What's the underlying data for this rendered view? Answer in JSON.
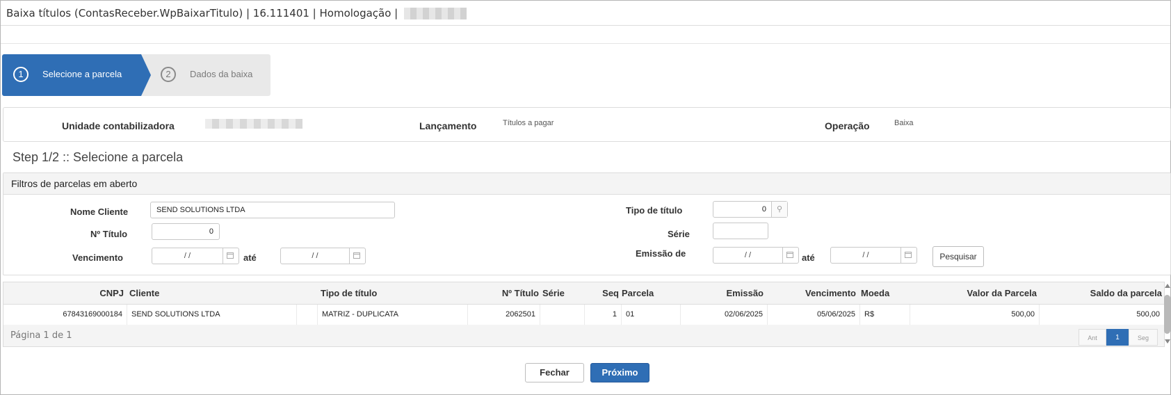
{
  "window": {
    "title": "Baixa títulos (ContasReceber.WpBaixarTitulo) | 16.111401 | Homologação |"
  },
  "wizard": {
    "steps": [
      {
        "number": "1",
        "label": "Selecione a parcela",
        "active": true
      },
      {
        "number": "2",
        "label": "Dados da baixa",
        "active": false
      }
    ]
  },
  "info": {
    "unidade_label": "Unidade contabilizadora",
    "lancamento_label": "Lançamento",
    "lancamento_value": "Títulos a pagar",
    "operacao_label": "Operação",
    "operacao_value": "Baixa"
  },
  "step_title": "Step 1/2 :: Selecione a parcela",
  "filters": {
    "header": "Filtros de parcelas em aberto",
    "nome_cliente_label": "Nome Cliente",
    "nome_cliente_value": "SEND SOLUTIONS LTDA",
    "no_titulo_label": "Nº Título",
    "no_titulo_value": "0",
    "vencimento_label": "Vencimento",
    "vencimento_de": "/ /",
    "vencimento_ate": "/ /",
    "ate_label": "até",
    "tipo_titulo_label": "Tipo de título",
    "tipo_titulo_value": "0",
    "serie_label": "Série",
    "serie_value": "",
    "emissao_label": "Emissão de",
    "emissao_de": "/ /",
    "emissao_ate": "/ /",
    "search_button": "Pesquisar"
  },
  "grid": {
    "columns": [
      "CNPJ",
      "Cliente",
      "Tipo de título",
      "Nº Título",
      "Série",
      "Seq",
      "Parcela",
      "Emissão",
      "Vencimento",
      "Moeda",
      "Valor da Parcela",
      "Saldo da parcela"
    ],
    "rows": [
      {
        "cnpj": "67843169000184",
        "cliente": "SEND SOLUTIONS LTDA",
        "tipo_titulo": "MATRIZ - DUPLICATA",
        "no_titulo": "2062501",
        "serie": "",
        "seq": "1",
        "parcela": "01",
        "emissao": "02/06/2025",
        "vencimento": "05/06/2025",
        "moeda": "R$",
        "valor_parcela": "500,00",
        "saldo_parcela": "500,00"
      }
    ],
    "page_info": "Página 1 de 1",
    "pagination": {
      "prev": "Ant",
      "current": "1",
      "next": "Seg"
    }
  },
  "actions": {
    "close": "Fechar",
    "next": "Próximo"
  },
  "colors": {
    "primary": "#2f6eb5",
    "header_bg": "#f4f4f4"
  }
}
